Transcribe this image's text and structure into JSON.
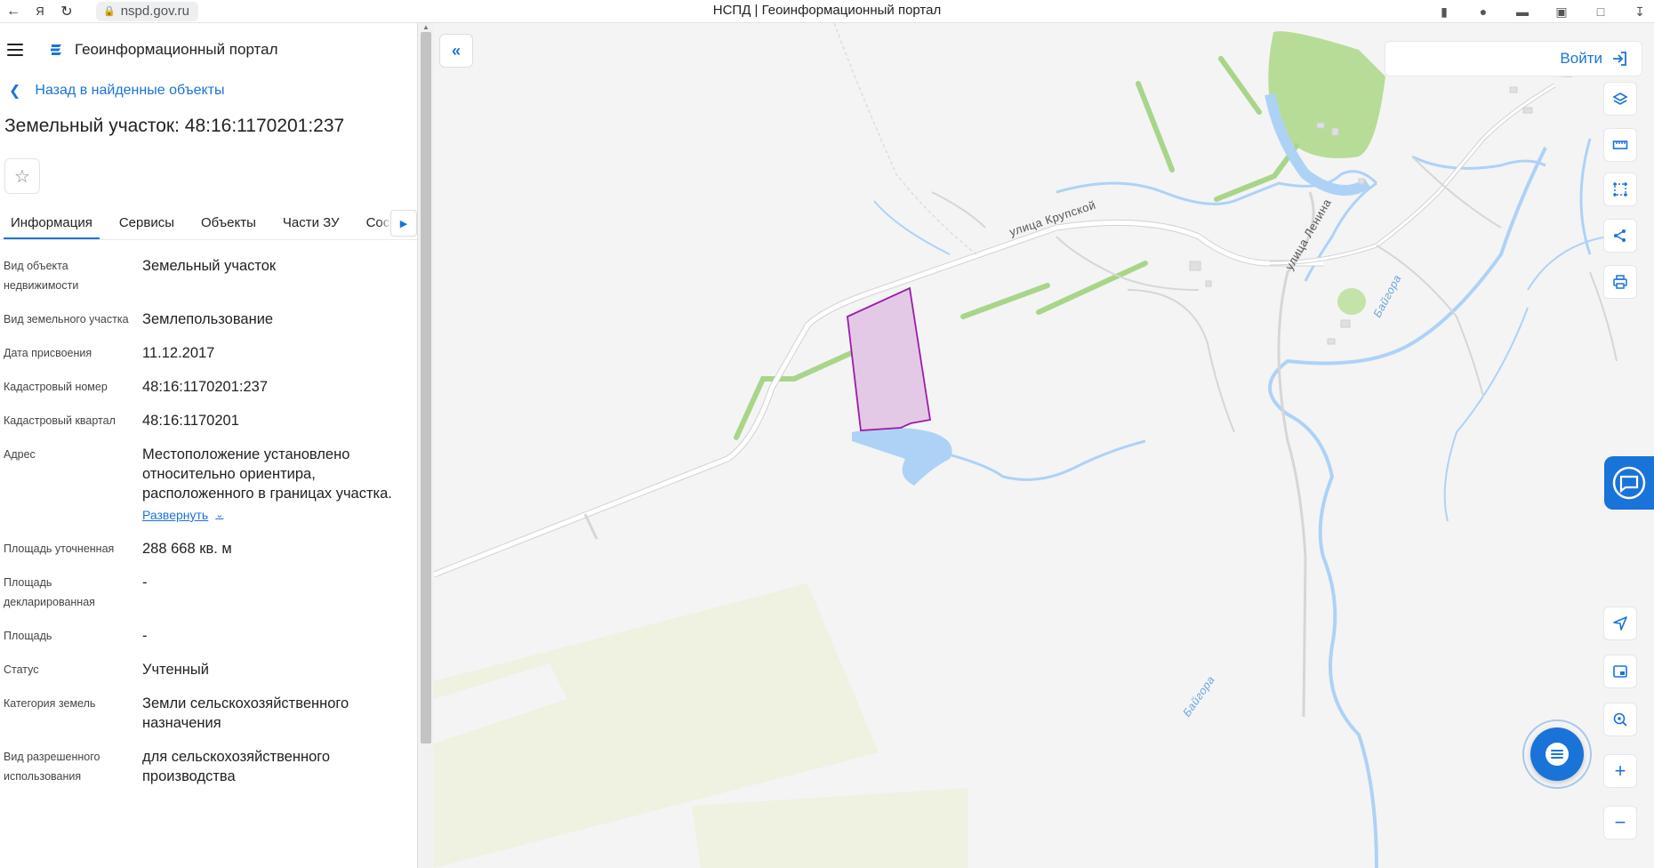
{
  "browser": {
    "url": "nspd.gov.ru",
    "tab_title": "НСПД | Геоинформационный портал"
  },
  "header": {
    "portal_name": "Геоинформационный портал"
  },
  "back_link": "Назад в найденные объекты",
  "object_title": "Земельный участок: 48:16:1170201:237",
  "tabs": [
    {
      "label": "Информация",
      "active": true
    },
    {
      "label": "Сервисы"
    },
    {
      "label": "Объекты"
    },
    {
      "label": "Части ЗУ"
    },
    {
      "label": "Соста"
    }
  ],
  "properties": [
    {
      "label": "Вид объекта недвижимости",
      "value": "Земельный участок"
    },
    {
      "label": "Вид земельного участка",
      "value": "Землепользование"
    },
    {
      "label": "Дата присвоения",
      "value": "11.12.2017"
    },
    {
      "label": "Кадастровый номер",
      "value": "48:16:1170201:237"
    },
    {
      "label": "Кадастровый квартал",
      "value": "48:16:1170201"
    },
    {
      "label": "Адрес",
      "value": "Местоположение установлено относительно ориентира, расположенного в границах участка."
    },
    {
      "label": "Площадь уточненная",
      "value": "288 668 кв. м"
    },
    {
      "label": "Площадь декларированная",
      "value": "-"
    },
    {
      "label": "Площадь",
      "value": "-"
    },
    {
      "label": "Статус",
      "value": "Учтенный"
    },
    {
      "label": "Категория земель",
      "value": "Земли сельскохозяйственного назначения"
    },
    {
      "label": "Вид разрешенного использования",
      "value": "для сельскохозяйственного производства"
    }
  ],
  "expand_label": "Развернуть",
  "map": {
    "login_label": "Войти",
    "street_labels": [
      "улица Крупской",
      "улица Ленина"
    ],
    "river_labels": [
      "Байгора",
      "Байгора"
    ],
    "tools": [
      "layers-icon",
      "ruler-icon",
      "select-area-icon",
      "share-icon",
      "print-icon"
    ],
    "bottom_tools": [
      "locate-icon",
      "minimap-icon",
      "pin-search-icon",
      "zoom-in-icon",
      "zoom-out-icon"
    ],
    "colors": {
      "parcel_fill": "#e3c9e6",
      "parcel_stroke": "#9c1ca8",
      "water": "#aed2f5",
      "green": "#b7dc98",
      "field": "#eff1e1"
    }
  }
}
